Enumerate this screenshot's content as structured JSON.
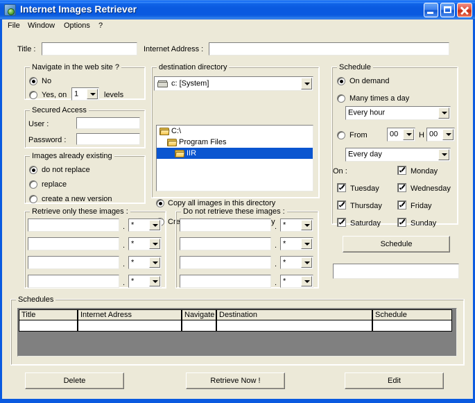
{
  "window": {
    "title": "Internet Images Retriever",
    "icon": "app-globe-icon",
    "controls": {
      "minimize": "_",
      "maximize": "□",
      "close": "✕"
    },
    "accent_title_color": "#0a5ae0",
    "face_color": "#ece9d8"
  },
  "menu": {
    "items": [
      "File",
      "Window",
      "Options",
      "?"
    ]
  },
  "top_fields": {
    "title_label": "Title :",
    "title_value": "",
    "address_label": "Internet Address :",
    "address_value": ""
  },
  "navigate_group": {
    "legend": "Navigate in the web site ?",
    "option_no": "No",
    "option_yes": "Yes, on",
    "levels_value": "1",
    "levels_suffix": "levels",
    "selected": "No"
  },
  "secured_group": {
    "legend": "Secured Access",
    "user_label": "User :",
    "user_value": "",
    "password_label": "Password :",
    "password_value": ""
  },
  "existing_group": {
    "legend": "Images already existing",
    "options": [
      "do not replace",
      "replace",
      "create a new version"
    ],
    "selected": "do not replace"
  },
  "destination_group": {
    "legend": "destination directory",
    "drive_value": "c: [System]",
    "tree": [
      {
        "label": "C:\\",
        "indent": 0,
        "selected": false
      },
      {
        "label": "Program Files",
        "indent": 1,
        "selected": false
      },
      {
        "label": "IIR",
        "indent": 2,
        "selected": true
      }
    ],
    "option_copy": "Copy all images in this directory",
    "option_tree": "Create a tree from this directory",
    "selected": "Copy all images in this directory"
  },
  "retrieve_only_group": {
    "legend": "Retrieve only these images :",
    "separator": ".",
    "rows": [
      {
        "name": "",
        "ext": "*"
      },
      {
        "name": "",
        "ext": "*"
      },
      {
        "name": "",
        "ext": "*"
      },
      {
        "name": "",
        "ext": "*"
      }
    ]
  },
  "do_not_retrieve_group": {
    "legend": "Do not retrieve these images :",
    "separator": ".",
    "rows": [
      {
        "name": "",
        "ext": "*"
      },
      {
        "name": "",
        "ext": "*"
      },
      {
        "name": "",
        "ext": "*"
      },
      {
        "name": "",
        "ext": "*"
      }
    ]
  },
  "schedule_group": {
    "legend": "Schedule",
    "option_on_demand": "On demand",
    "option_many_times": "Many times a day",
    "frequency_value": "Every hour",
    "option_from": "From",
    "from_hour": "00",
    "hour_separator": "H",
    "from_minute": "00",
    "day_frequency_value": "Every day",
    "selected": "On demand",
    "on_label": "On :",
    "days": [
      {
        "label": "Monday",
        "checked": true
      },
      {
        "label": "Tuesday",
        "checked": true
      },
      {
        "label": "Wednesday",
        "checked": true
      },
      {
        "label": "Thursday",
        "checked": true
      },
      {
        "label": "Friday",
        "checked": true
      },
      {
        "label": "Saturday",
        "checked": true
      },
      {
        "label": "Sunday",
        "checked": true
      }
    ],
    "schedule_button": "Schedule",
    "status_value": ""
  },
  "schedules_group": {
    "legend": "Schedules",
    "columns": [
      "Title",
      "Internet Adress",
      "Navigate",
      "Destination",
      "Schedule"
    ],
    "rows": [
      {
        "title": "",
        "address": "",
        "navigate": "",
        "destination": "",
        "schedule": ""
      }
    ],
    "empty_area_color": "#808080"
  },
  "bottom_buttons": {
    "delete": "Delete",
    "retrieve_now": "Retrieve Now !",
    "edit": "Edit"
  }
}
